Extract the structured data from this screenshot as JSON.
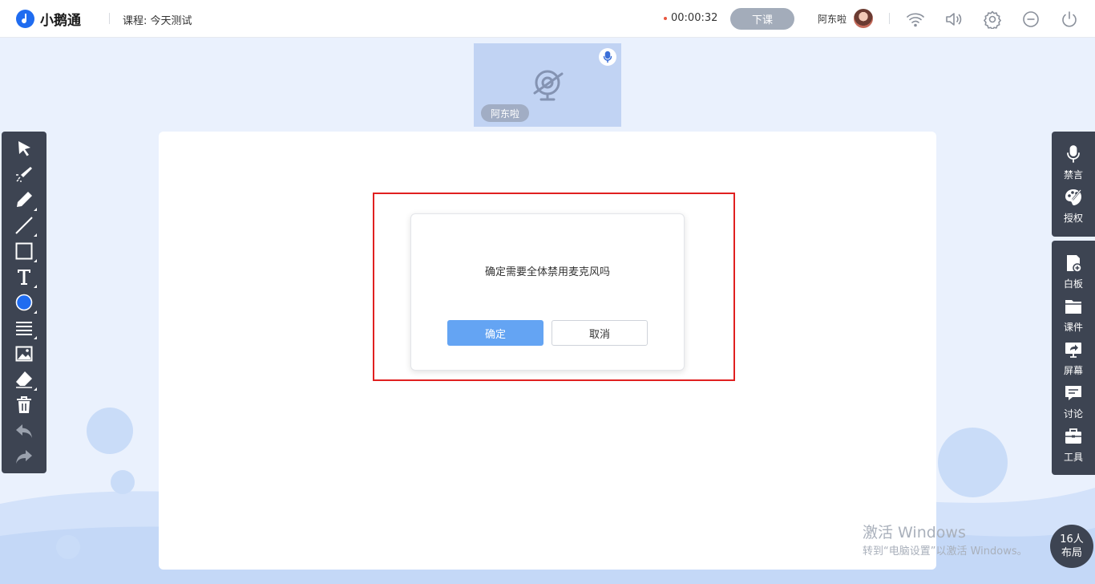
{
  "app": {
    "name": "小鹅通"
  },
  "header": {
    "course_label": "课程: 今天测试",
    "timer": "00:00:32",
    "end_class_label": "下课",
    "user_name": "阿东啦"
  },
  "video_tile": {
    "name": "阿东啦"
  },
  "dialog": {
    "message": "确定需要全体禁用麦克风吗",
    "confirm_label": "确定",
    "cancel_label": "取消"
  },
  "right_panel_top": [
    {
      "label": "禁言",
      "icon": "microphone-icon"
    },
    {
      "label": "授权",
      "icon": "palette-icon"
    }
  ],
  "right_panel_bottom": [
    {
      "label": "白板",
      "icon": "whiteboard-icon"
    },
    {
      "label": "课件",
      "icon": "folder-icon"
    },
    {
      "label": "屏幕",
      "icon": "screen-share-icon"
    },
    {
      "label": "讨论",
      "icon": "chat-icon"
    },
    {
      "label": "工具",
      "icon": "toolbox-icon"
    }
  ],
  "layout_button": {
    "line1": "16人",
    "line2": "布局"
  },
  "watermark": {
    "line1": "激活 Windows",
    "line2": "转到“电脑设置”以激活 Windows。"
  },
  "colors": {
    "accent": "#1f6cf0",
    "toolbar_bg": "#3d4452",
    "confirm_bg": "#64a4f3",
    "highlight": "#e02020"
  }
}
